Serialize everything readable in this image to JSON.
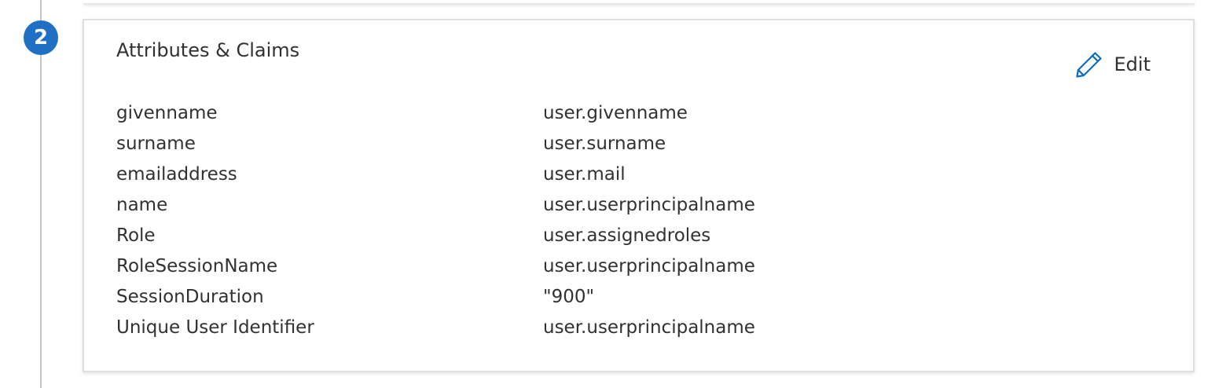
{
  "step": {
    "number": "2",
    "badge_color": "#1f6fc4"
  },
  "card": {
    "title": "Attributes & Claims",
    "edit_label": "Edit",
    "edit_icon": "pencil-icon",
    "accent_color": "#0f6cbd"
  },
  "claims": [
    {
      "name": "givenname",
      "value": "user.givenname"
    },
    {
      "name": "surname",
      "value": "user.surname"
    },
    {
      "name": "emailaddress",
      "value": "user.mail"
    },
    {
      "name": "name",
      "value": "user.userprincipalname"
    },
    {
      "name": "Role",
      "value": "user.assignedroles"
    },
    {
      "name": "RoleSessionName",
      "value": "user.userprincipalname"
    },
    {
      "name": "SessionDuration",
      "value": "\"900\""
    },
    {
      "name": "Unique User Identifier",
      "value": "user.userprincipalname"
    }
  ]
}
